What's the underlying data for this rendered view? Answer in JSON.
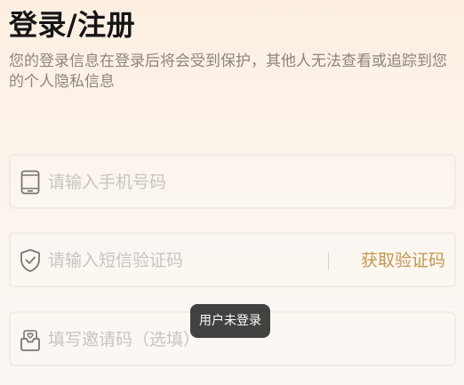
{
  "page": {
    "title": "登录/注册",
    "subtitle": "您的登录信息在登录后将会受到保护，其他人无法查看或追踪到您的个人隐私信息"
  },
  "form": {
    "phone": {
      "placeholder": "请输入手机号码",
      "value": "",
      "icon": "phone-icon"
    },
    "sms": {
      "placeholder": "请输入短信验证码",
      "value": "",
      "icon": "shield-check-icon",
      "get_code_label": "获取验证码"
    },
    "invite": {
      "placeholder": "填写邀请码（选填）",
      "value": "",
      "icon": "inbox-heart-icon"
    }
  },
  "toast": {
    "text": "用户未登录"
  },
  "colors": {
    "accent": "#c49750",
    "placeholder": "#c8c4c0",
    "icon": "#7a7570"
  }
}
